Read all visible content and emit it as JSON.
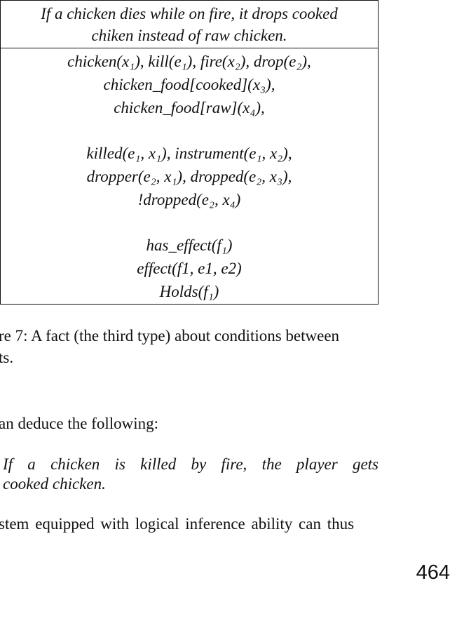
{
  "figure": {
    "caption_line1": "If a chicken dies while on fire, it drops cooked",
    "caption_line2": "chiken instead of raw chicken.",
    "lines": [
      "chicken(x₁), kill(e₁), fire(x₂), drop(e₂),",
      "chicken_food[cooked](x₃),",
      "chicken_food[raw](x₄),",
      "killed(e₁, x₁), instrument(e₁, x₂),",
      "dropper(e₂, x₁), dropped(e₂, x₃),",
      "!dropped(e₂, x₄)",
      "has_effect(f₁)",
      "effect(f1, e1, e2)",
      "Holds(f₁)"
    ]
  },
  "figure_caption": {
    "line1": "re 7:  A fact (the third type) about conditions between",
    "line2": "ts."
  },
  "body": {
    "deduce": "an deduce the following:",
    "conclusion_line1": "If a chicken is killed by fire, the player gets",
    "conclusion_line2": "cooked chicken.",
    "system": "stem equipped with logical inference ability can thus"
  },
  "page_number": "464"
}
